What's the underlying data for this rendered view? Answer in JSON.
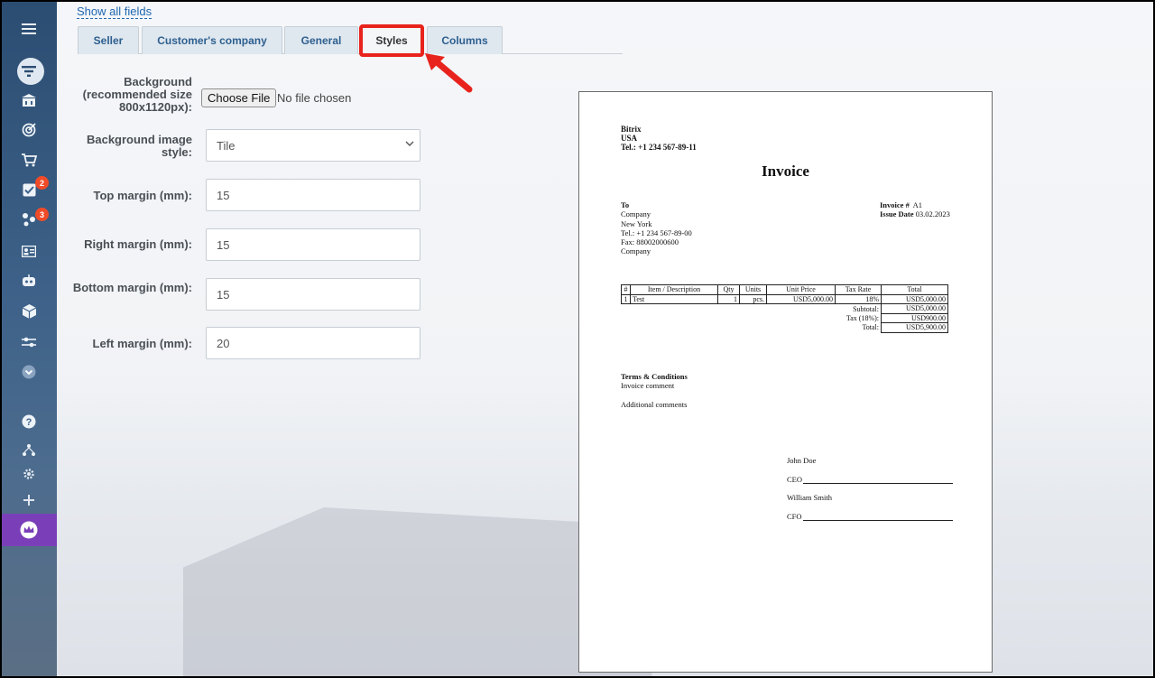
{
  "sidebar": {
    "badges": {
      "tasks": "2",
      "feed": "3"
    }
  },
  "header": {
    "show_all_fields": "Show all fields"
  },
  "tabs": [
    {
      "label": "Seller",
      "active": false
    },
    {
      "label": "Customer's company",
      "active": false
    },
    {
      "label": "General",
      "active": false
    },
    {
      "label": "Styles",
      "active": true
    },
    {
      "label": "Columns",
      "active": false
    }
  ],
  "form": {
    "background_label": "Background (recommended size 800x1120px):",
    "choose_file": "Choose File",
    "no_file": "No file chosen",
    "bg_style_label": "Background image style:",
    "bg_style_value": "Tile",
    "top_margin_label": "Top margin (mm):",
    "top_margin": "15",
    "right_margin_label": "Right margin (mm):",
    "right_margin": "15",
    "bottom_margin_label": "Bottom margin (mm):",
    "bottom_margin": "15",
    "left_margin_label": "Left margin (mm):",
    "left_margin": "20"
  },
  "invoice": {
    "seller_name": "Bitrix",
    "seller_country": "USA",
    "seller_phone": "Tel.: +1 234 567-89-11",
    "title": "Invoice",
    "to_label": "To",
    "to_company": "Company",
    "to_city": "New York",
    "to_phone": "Tel.: +1 234 567-89-00",
    "to_fax": "Fax: 88002000600",
    "to_company2": "Company",
    "invoice_no_label": "Invoice #",
    "invoice_no": "A1",
    "issue_date_label": "Issue Date",
    "issue_date": "03.02.2023",
    "table_headers": [
      "#",
      "Item / Description",
      "Qty",
      "Units",
      "Unit Price",
      "Tax Rate",
      "Total"
    ],
    "row": [
      "1",
      "Test",
      "1",
      "pcs.",
      "USD5,000.00",
      "18%",
      "USD5,000.00"
    ],
    "subtotal_label": "Subtotal:",
    "subtotal": "USD5,000.00",
    "tax_label": "Tax (18%):",
    "tax": "USD900.00",
    "total_label": "Total:",
    "total": "USD5,900.00",
    "terms_title": "Terms & Conditions",
    "terms_text": "Invoice comment",
    "additional": "Additional comments",
    "signer1": "John Doe",
    "role1": "CEO",
    "signer2": "William Smith",
    "role2": "CFO"
  },
  "colors": {
    "accent": "#2067b0",
    "highlight": "#e8231d",
    "badge": "#f04b28",
    "crown_band": "#7a3fb8"
  }
}
